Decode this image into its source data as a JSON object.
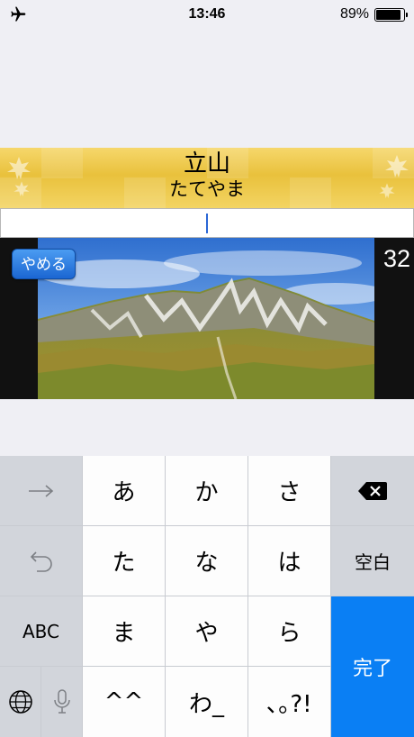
{
  "status_bar": {
    "airplane_icon": "airplane-icon",
    "time": "13:46",
    "battery_percent": "89%",
    "battery_level": 0.89
  },
  "banner": {
    "title": "立山",
    "reading": "たてやま"
  },
  "answer_input": {
    "value": ""
  },
  "quiz": {
    "quit_label": "やめる",
    "counter": "32"
  },
  "keyboard": {
    "row1": [
      "あ",
      "か",
      "さ"
    ],
    "row2": [
      "た",
      "な",
      "は"
    ],
    "row3": [
      "ま",
      "や",
      "ら"
    ],
    "row4": [
      "^^",
      "わ_",
      "､｡?!"
    ],
    "abc_label": "ABC",
    "space_label": "空白",
    "done_label": "完了",
    "icons": {
      "next": "arrow-right-icon",
      "undo": "undo-icon",
      "delete": "delete-icon",
      "globe": "globe-icon",
      "mic": "microphone-icon"
    }
  },
  "colors": {
    "banner_gold": "#e9c13c",
    "quit_button": "#1b66d2",
    "done_key": "#0a7ff4",
    "caret": "#2a67d6"
  }
}
